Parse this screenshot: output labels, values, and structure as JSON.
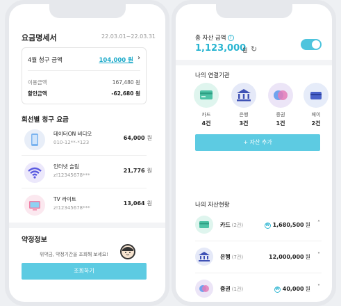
{
  "left": {
    "title": "요금명세서",
    "period": "22.03.01~22.03.31",
    "bill": {
      "label": "4월 청구 금액",
      "amount": "104,000 원",
      "usage_label": "이용금액",
      "usage_value": "167,480 원",
      "discount_label": "할인금액",
      "discount_value": "-62,680 원"
    },
    "lines_title": "회선별 청구 요금",
    "lines": [
      {
        "name": "데이터ON 비디오",
        "number": "010-12**-*123",
        "price": "64,000",
        "unit": "원",
        "icon": "smartphone-icon"
      },
      {
        "name": "인터넷 슬림",
        "number": "z!12345678***",
        "price": "21,776",
        "unit": "원",
        "icon": "wifi-icon"
      },
      {
        "name": "TV 라이트",
        "number": "z!12345678***",
        "price": "13,064",
        "unit": "원",
        "icon": "tv-icon"
      }
    ],
    "contract_title": "약정정보",
    "contract_desc": "위약금, 약정기간을 조회해 보세요!",
    "inquiry_button": "조회하기"
  },
  "right": {
    "total_label": "총 자산 금액",
    "total_amount": "1,123,000",
    "total_unit": "원",
    "institutions_title": "나의 연결기관",
    "institutions": [
      {
        "name": "카드",
        "count": "4건",
        "icon": "card-icon"
      },
      {
        "name": "은행",
        "count": "3건",
        "icon": "bank-icon"
      },
      {
        "name": "증권",
        "count": "1건",
        "icon": "securities-icon"
      },
      {
        "name": "페이",
        "count": "2건",
        "icon": "pay-icon"
      }
    ],
    "add_button": "+ 자산 추가",
    "assets_title": "나의 자산현황",
    "assets": [
      {
        "name": "카드",
        "count": "(2건)",
        "amount": "1,680,500",
        "unit": "원",
        "icon": "card-icon",
        "chevron": "˄"
      },
      {
        "name": "은행",
        "count": "(7건)",
        "amount": "12,000,000",
        "unit": "원",
        "icon": "bank-icon",
        "chevron": "˅"
      },
      {
        "name": "증권",
        "count": "(1건)",
        "amount": "40,000",
        "unit": "원",
        "icon": "securities-icon",
        "chevron": "˅"
      }
    ]
  },
  "colors": {
    "accent": "#29b5d1",
    "button": "#5dcbe2"
  }
}
